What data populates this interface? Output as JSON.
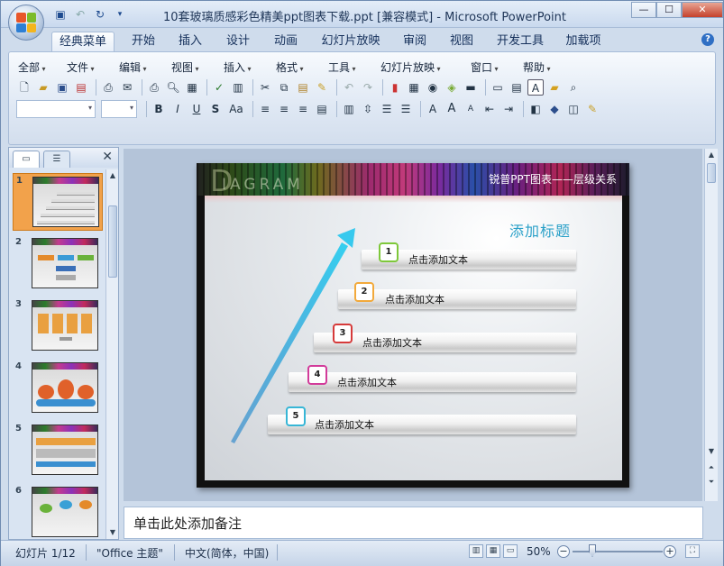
{
  "window": {
    "title": "10套玻璃质感彩色精美ppt图表下载.ppt [兼容模式] - Microsoft PowerPoint",
    "controls": {
      "minimize": "—",
      "maximize": "☐",
      "close": "✕"
    }
  },
  "ribbon_tabs": [
    "经典菜单",
    "开始",
    "插入",
    "设计",
    "动画",
    "幻灯片放映",
    "审阅",
    "视图",
    "开发工具",
    "加载项"
  ],
  "classic_menu": [
    "全部",
    "文件",
    "编辑",
    "视图",
    "插入",
    "格式",
    "工具",
    "幻灯片放映",
    "窗口",
    "帮助"
  ],
  "toolbar_icons": {
    "row1": [
      "new-icon",
      "open-icon",
      "save-icon",
      "permission-icon",
      "print-preview-icon",
      "email-icon",
      "print-icon",
      "preview-icon",
      "research-icon",
      "spelling-icon",
      "cut-icon",
      "copy-icon",
      "paste-icon",
      "format-painter-icon",
      "undo-icon",
      "redo-icon",
      "chart-icon",
      "table-icon",
      "hyperlink-icon",
      "color-icon",
      "line-icon",
      "new-slide-icon",
      "layout-icon",
      "textbox-icon",
      "folder-icon",
      "zoom-icon"
    ],
    "row2": [
      "bold-icon",
      "italic-icon",
      "underline-icon",
      "shadow-icon",
      "change-case-icon",
      "align-left-icon",
      "align-center-icon",
      "align-right-icon",
      "justify-icon",
      "columns-icon",
      "line-spacing-icon",
      "numbering-icon",
      "bullets-icon",
      "font-color-icon",
      "grow-font-icon",
      "shrink-font-icon",
      "decrease-indent-icon",
      "increase-indent-icon",
      "shapes-icon",
      "arrange-icon",
      "quick-styles-icon"
    ]
  },
  "toolbar_glyphs": {
    "row2_text": {
      "bold": "B",
      "italic": "I",
      "underline": "U",
      "shadow": "S",
      "case": "Aa",
      "font_color": "A",
      "grow": "A",
      "shrink": "A"
    },
    "font_color_box": "A"
  },
  "slides_panel": {
    "tabs": [
      "slides-tab",
      "outline-tab"
    ],
    "close": "✕",
    "thumbnails": [
      {
        "num": "1",
        "selected": true
      },
      {
        "num": "2",
        "selected": false
      },
      {
        "num": "3",
        "selected": false
      },
      {
        "num": "4",
        "selected": false
      },
      {
        "num": "5",
        "selected": false
      },
      {
        "num": "6",
        "selected": false
      }
    ]
  },
  "slide": {
    "header_word": "IAGRAM",
    "header_letter": "D",
    "subtitle": "锐普PPT图表——层级关系",
    "add_title": "添加标题",
    "steps": [
      {
        "num": "1",
        "label": "点击添加文本",
        "color": "#7ec83a"
      },
      {
        "num": "2",
        "label": "点击添加文本",
        "color": "#f2a93b"
      },
      {
        "num": "3",
        "label": "点击添加文本",
        "color": "#d63a3a"
      },
      {
        "num": "4",
        "label": "点击添加文本",
        "color": "#d23b9a"
      },
      {
        "num": "5",
        "label": "点击添加文本",
        "color": "#37b6d6"
      }
    ],
    "arrow_color": "#2bb8e0"
  },
  "notes": {
    "placeholder": "单击此处添加备注"
  },
  "status_bar": {
    "slide_info": "幻灯片 1/12",
    "theme": "\"Office 主题\"",
    "language": "中文(简体，中国)",
    "zoom": "50%",
    "zoom_out": "−",
    "zoom_in": "+"
  }
}
